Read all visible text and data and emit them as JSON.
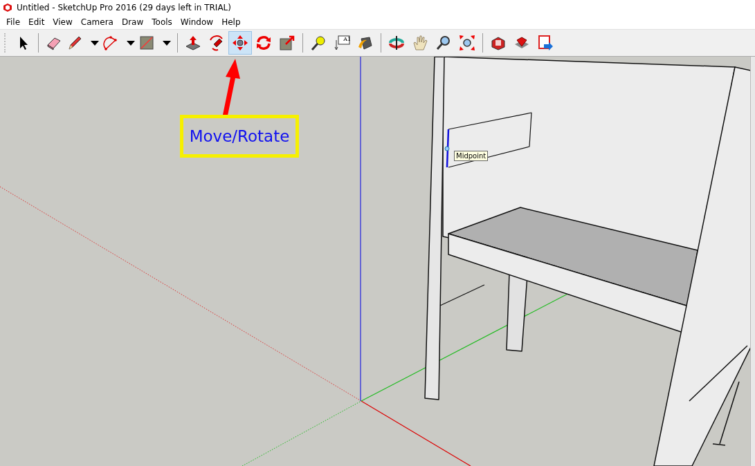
{
  "window": {
    "title": "Untitled - SketchUp Pro 2016 (29 days left in TRIAL)"
  },
  "menu": [
    "File",
    "Edit",
    "View",
    "Camera",
    "Draw",
    "Tools",
    "Window",
    "Help"
  ],
  "toolbar": [
    [
      {
        "selected": false,
        "dropdown": false
      }
    ],
    [
      {
        "selected": false,
        "dropdown": false
      },
      {
        "selected": false,
        "dropdown": true
      },
      {
        "selected": false,
        "dropdown": true
      },
      {
        "selected": false,
        "dropdown": true
      }
    ],
    [
      {
        "selected": false,
        "dropdown": false
      },
      {
        "selected": false,
        "dropdown": false
      },
      {
        "selected": true,
        "dropdown": false
      },
      {
        "selected": false,
        "dropdown": false
      },
      {
        "selected": false,
        "dropdown": false
      }
    ],
    [
      {
        "selected": false,
        "dropdown": false
      },
      {
        "selected": false,
        "dropdown": false,
        "label": "A1"
      },
      {
        "selected": false,
        "dropdown": false
      }
    ],
    [
      {
        "selected": false,
        "dropdown": false
      },
      {
        "selected": false,
        "dropdown": false
      },
      {
        "selected": false,
        "dropdown": false
      },
      {
        "selected": false,
        "dropdown": false
      }
    ],
    [
      {
        "selected": false,
        "dropdown": false
      },
      {
        "selected": false,
        "dropdown": false
      },
      {
        "selected": false,
        "dropdown": false
      }
    ]
  ],
  "callout": {
    "label": "Move/Rotate"
  },
  "tooltip": "Midpoint"
}
